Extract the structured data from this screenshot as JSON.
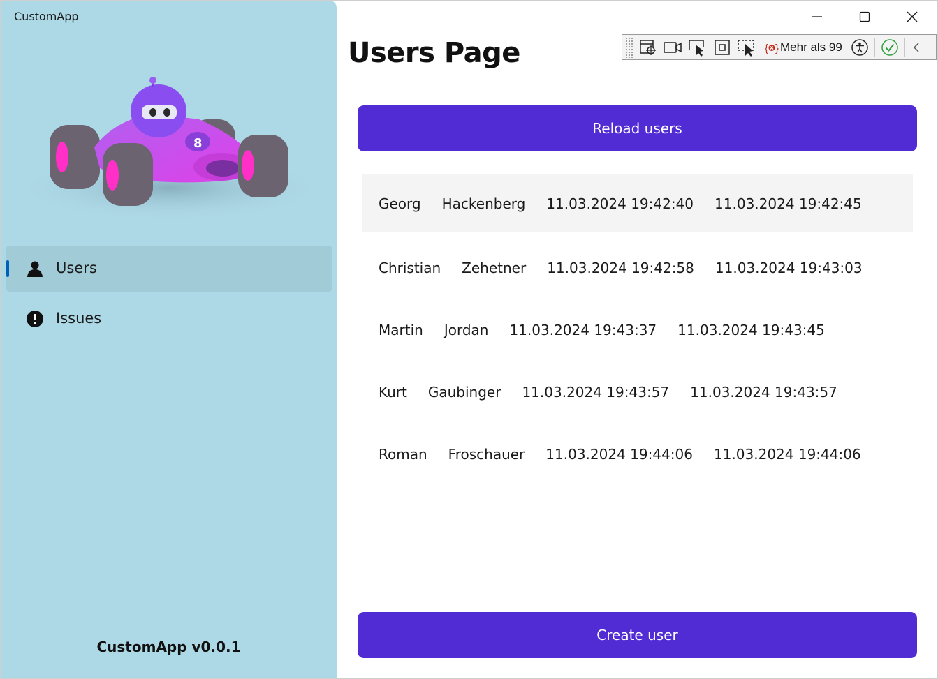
{
  "app": {
    "title": "CustomApp",
    "version": "CustomApp v0.0.1"
  },
  "nav": {
    "items": [
      {
        "label": "Users",
        "icon": "person-icon",
        "selected": true
      },
      {
        "label": "Issues",
        "icon": "exclamation-icon",
        "selected": false
      }
    ]
  },
  "toolbar": {
    "errors_label": "Mehr als 99"
  },
  "page": {
    "title": "Users Page",
    "reload_label": "Reload users",
    "create_label": "Create user"
  },
  "users": [
    {
      "first": "Georg",
      "last": "Hackenberg",
      "created": "11.03.2024 19:42:40",
      "updated": "11.03.2024 19:42:45"
    },
    {
      "first": "Christian",
      "last": "Zehetner",
      "created": "11.03.2024 19:42:58",
      "updated": "11.03.2024 19:43:03"
    },
    {
      "first": "Martin",
      "last": "Jordan",
      "created": "11.03.2024 19:43:37",
      "updated": "11.03.2024 19:43:45"
    },
    {
      "first": "Kurt",
      "last": "Gaubinger",
      "created": "11.03.2024 19:43:57",
      "updated": "11.03.2024 19:43:57"
    },
    {
      "first": "Roman",
      "last": "Froschauer",
      "created": "11.03.2024 19:44:06",
      "updated": "11.03.2024 19:44:06"
    }
  ],
  "colors": {
    "sidebar_bg": "#add8e6",
    "accent": "#512bd4",
    "nav_indicator": "#005fb8",
    "selected_row_bg": "#f4f4f4"
  }
}
